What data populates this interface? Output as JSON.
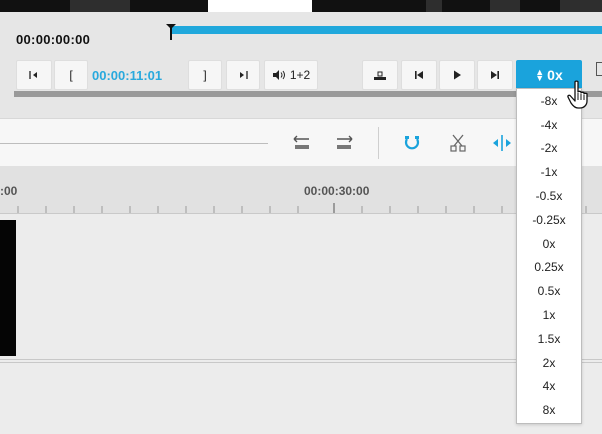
{
  "player": {
    "timecode_total": "00:00:00:00",
    "current_timecode": "00:00:11:01",
    "buttons": {
      "go_in": "[◂",
      "mark_in": "[",
      "mark_out": "]",
      "go_out": "▸]",
      "audio": "1+2"
    },
    "speed": {
      "current": "0x",
      "options": [
        "-8x",
        "-4x",
        "-2x",
        "-1x",
        "-0.5x",
        "-0.25x",
        "0x",
        "0.25x",
        "0.5x",
        "1x",
        "1.5x",
        "2x",
        "4x",
        "8x"
      ]
    }
  },
  "ruler": {
    "labels": [
      ":00",
      "00:00:30:00"
    ]
  },
  "colors": {
    "accent": "#1aa3dc",
    "timecode": "#29a9dd",
    "clip": "#050505"
  }
}
